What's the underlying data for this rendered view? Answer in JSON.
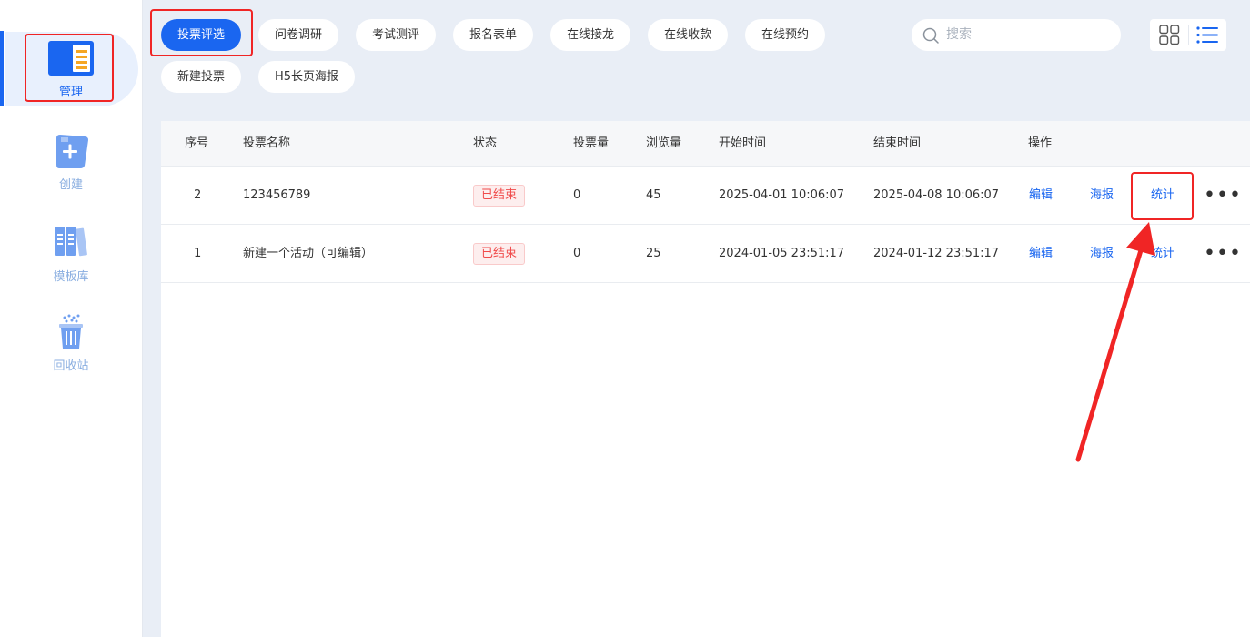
{
  "sidebar": {
    "items": [
      {
        "label": "管理",
        "icon": "document-list-icon"
      },
      {
        "label": "创建",
        "icon": "add-document-icon"
      },
      {
        "label": "模板库",
        "icon": "books-icon"
      },
      {
        "label": "回收站",
        "icon": "trash-icon"
      }
    ]
  },
  "categories": [
    "投票评选",
    "问卷调研",
    "考试测评",
    "报名表单",
    "在线接龙",
    "在线收款",
    "在线预约",
    "新建投票",
    "H5长页海报"
  ],
  "search": {
    "placeholder": "搜索"
  },
  "table": {
    "headers": {
      "index": "序号",
      "name": "投票名称",
      "status": "状态",
      "votes": "投票量",
      "views": "浏览量",
      "start": "开始时间",
      "end": "结束时间",
      "ops": "操作"
    },
    "rows": [
      {
        "index": "2",
        "name": "123456789",
        "status": "已结束",
        "votes": "0",
        "views": "45",
        "start": "2025-04-01 10:06:07",
        "end": "2025-04-08 10:06:07",
        "edit": "编辑",
        "poster": "海报",
        "stats": "统计",
        "more": "•••"
      },
      {
        "index": "1",
        "name": "新建一个活动（可编辑）",
        "status": "已结束",
        "votes": "0",
        "views": "25",
        "start": "2024-01-05 23:51:17",
        "end": "2024-01-12 23:51:17",
        "edit": "编辑",
        "poster": "海报",
        "stats": "统计",
        "more": "•••"
      }
    ]
  },
  "colors": {
    "accent": "#1a66f0",
    "highlight": "#f02525",
    "status_ended": "#f04b4b"
  }
}
